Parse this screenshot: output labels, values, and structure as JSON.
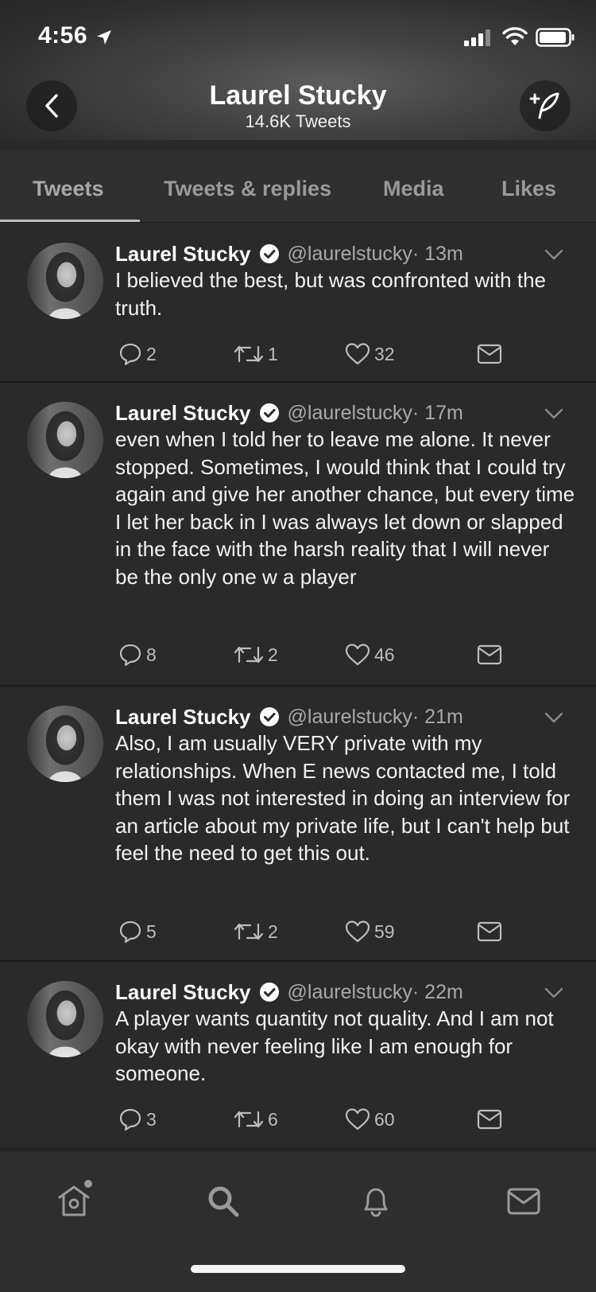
{
  "status_bar": {
    "time": "4:56"
  },
  "header": {
    "title": "Laurel Stucky",
    "subtitle": "14.6K Tweets"
  },
  "tabs": [
    {
      "label": "Tweets",
      "active": true
    },
    {
      "label": "Tweets & replies",
      "active": false
    },
    {
      "label": "Media",
      "active": false
    },
    {
      "label": "Likes",
      "active": false
    }
  ],
  "tweets": [
    {
      "name": "Laurel Stucky",
      "handle": "@laurelstucky",
      "time": " · 13m",
      "text": "I believed the best, but was confronted with the truth.",
      "replies": "2",
      "retweets": "1",
      "likes": "32"
    },
    {
      "name": "Laurel Stucky",
      "handle": "@laurelstucky",
      "time": " · 17m",
      "text": "even when I told her to leave me alone. It never stopped. Sometimes, I would think that I could try again and give her another chance, but every time I let her back in I was always let down or slapped in the face with the harsh reality that I will never be the only one w a player",
      "replies": "8",
      "retweets": "2",
      "likes": "46"
    },
    {
      "name": "Laurel Stucky",
      "handle": "@laurelstucky",
      "time": " · 21m",
      "text": "Also, I am usually VERY private with my relationships. When E news contacted me, I told them I was not interested in doing an interview for an article about my private life, but I can't help but feel the need to get this out.",
      "replies": "5",
      "retweets": "2",
      "likes": "59"
    },
    {
      "name": "Laurel Stucky",
      "handle": "@laurelstucky",
      "time": " · 22m",
      "text": "A player wants quantity not quality. And I am not okay with never feeling like I am enough for someone.",
      "replies": "3",
      "retweets": "6",
      "likes": "60"
    }
  ],
  "bottom_nav": [
    "home-icon",
    "search-icon",
    "bell-icon",
    "mail-icon"
  ],
  "colors": {
    "background": "#2a2a2a",
    "header": "#454545",
    "muted_text": "#a9a9a9",
    "icon": "#bdbdbd"
  }
}
